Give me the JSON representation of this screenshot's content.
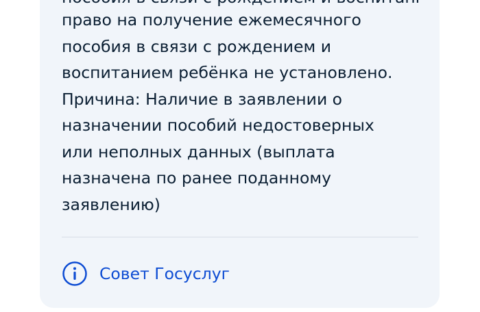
{
  "message": {
    "cut_top_line": "пособия в связи с рождением и воспитанием ребёнка",
    "text": "право на получение ежемесячного\nпособия в связи с рождением и\nвоспитанием ребёнка не установлено.\nПричина: Наличие в заявлении о\nназначении пособий недостоверных\nили неполных данных (выплата\nназначена по ранее поданному\nзаявлению)"
  },
  "tip": {
    "label": "Совет Госуслуг",
    "icon": "info-icon"
  },
  "colors": {
    "card_background": "#f1f5fa",
    "text": "#0b1f33",
    "link": "#0d4cd3",
    "divider": "#d6dde6"
  }
}
